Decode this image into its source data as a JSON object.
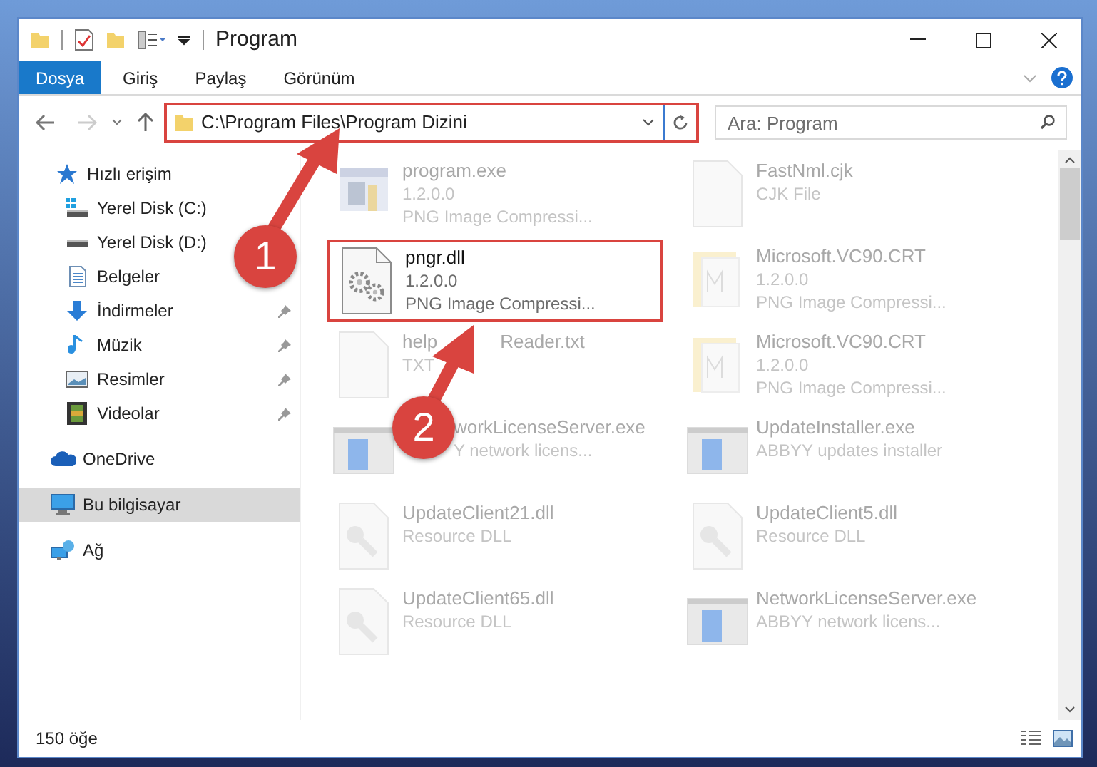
{
  "window": {
    "title": "Program"
  },
  "ribbon_tabs": [
    {
      "label": "Dosya",
      "selected": true
    },
    {
      "label": "Giriş",
      "selected": false
    },
    {
      "label": "Paylaş",
      "selected": false
    },
    {
      "label": "Görünüm",
      "selected": false
    }
  ],
  "address_bar": {
    "path": "C:\\Program Files\\Program Dizini",
    "highlighted": true
  },
  "search": {
    "placeholder": "Ara: Program"
  },
  "sidebar": {
    "items": [
      {
        "label": "Hızlı erişim",
        "pinned": false,
        "selected": false
      },
      {
        "label": "Yerel Disk (C:)",
        "pinned": false,
        "selected": false
      },
      {
        "label": "Yerel Disk (D:)",
        "pinned": false,
        "selected": false
      },
      {
        "label": "Belgeler",
        "pinned": false,
        "selected": false
      },
      {
        "label": "İndirmeler",
        "pinned": true,
        "selected": false
      },
      {
        "label": "Müzik",
        "pinned": true,
        "selected": false
      },
      {
        "label": "Resimler",
        "pinned": true,
        "selected": false
      },
      {
        "label": "Videolar",
        "pinned": true,
        "selected": false
      },
      {
        "label": "OneDrive",
        "pinned": false,
        "selected": false
      },
      {
        "label": "Bu bilgisayar",
        "pinned": false,
        "selected": true
      },
      {
        "label": "Ağ",
        "pinned": false,
        "selected": false
      }
    ]
  },
  "files": [
    {
      "kind": "faded",
      "name": [
        "program.exe"
      ],
      "lines": [
        [
          "1.2.0.0"
        ],
        [
          "PNG Image Compressi..."
        ]
      ]
    },
    {
      "kind": "faded",
      "name": [
        "FastNml.cjk"
      ],
      "lines": [
        [
          "CJK File"
        ]
      ]
    },
    {
      "kind": "highlighted",
      "name": [
        "pngr.dll"
      ],
      "lines": [
        [
          "1.2.0.0"
        ],
        [
          "PNG Image Compressi..."
        ]
      ]
    },
    {
      "kind": "faded",
      "name": [
        "Microsoft.VC90.CRT"
      ],
      "lines": [
        [
          "1.2.0.0"
        ],
        [
          "PNG Image Compressi..."
        ]
      ]
    },
    {
      "kind": "faded",
      "name": [
        "help",
        "Reader.txt"
      ],
      "lines": [
        [
          "TXT"
        ]
      ]
    },
    {
      "kind": "faded",
      "name": [
        "Microsoft.VC90.CRT"
      ],
      "lines": [
        [
          "1.2.0.0"
        ],
        [
          "PNG Image Compressi..."
        ]
      ]
    },
    {
      "kind": "covered",
      "name": [
        "workLicenseServer.exe"
      ],
      "lines": [
        [
          "Y network licens..."
        ]
      ]
    },
    {
      "kind": "faded",
      "name": [
        "UpdateInstaller.exe"
      ],
      "lines": [
        [
          "ABBYY updates installer"
        ]
      ]
    },
    {
      "kind": "faded",
      "name": [
        "UpdateClient21.dll"
      ],
      "lines": [
        [
          "Resource DLL"
        ]
      ]
    },
    {
      "kind": "faded",
      "name": [
        "UpdateClient5.dll"
      ],
      "lines": [
        [
          "Resource DLL"
        ]
      ]
    },
    {
      "kind": "faded",
      "name": [
        "UpdateClient65.dll"
      ],
      "lines": [
        [
          "Resource DLL"
        ]
      ]
    },
    {
      "kind": "faded",
      "name": [
        "NetworkLicenseServer.exe"
      ],
      "lines": [
        [
          "ABBYY network licens..."
        ]
      ]
    }
  ],
  "status_bar": {
    "count": "150 öğe"
  },
  "callouts": [
    {
      "number": "1"
    },
    {
      "number": "2"
    }
  ]
}
